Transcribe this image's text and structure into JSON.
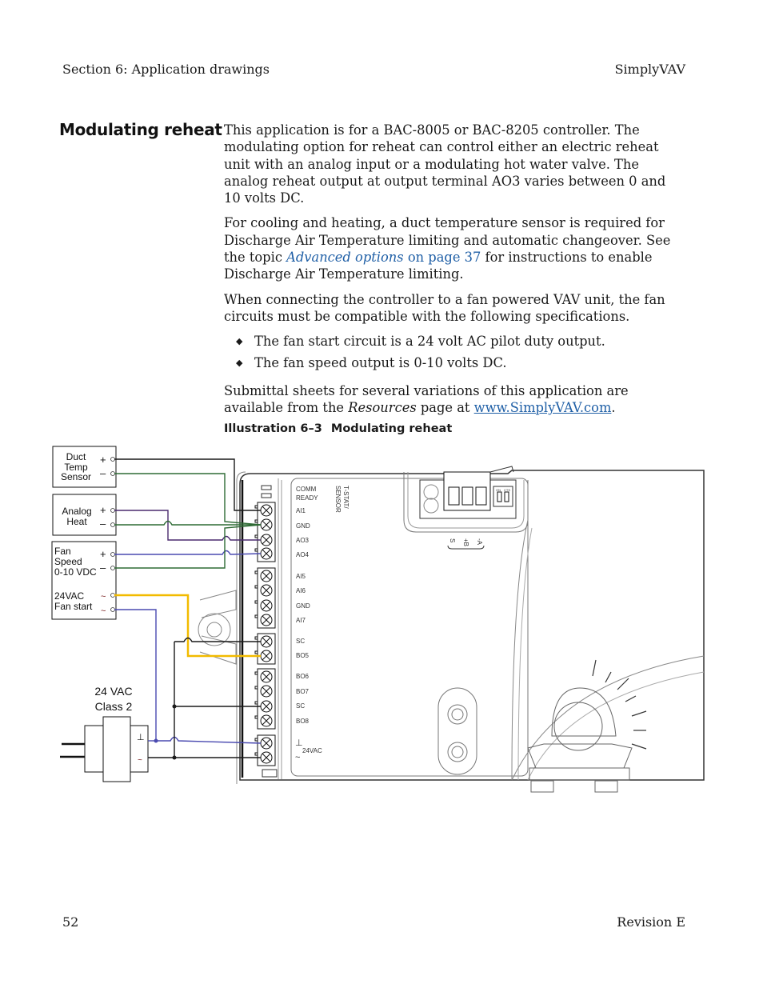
{
  "header": {
    "section": "Section 6: Application drawings",
    "product": "SimplyVAV"
  },
  "footer": {
    "page_number": "52",
    "revision": "Revision E"
  },
  "section_title": "Modulating reheat",
  "body": {
    "p1": "This application is for a BAC-8005 or BAC-8205 controller. The modulating option for reheat can control either an electric reheat unit with an analog input or a modulating hot water valve. The analog reheat output at output terminal AO3 varies between 0 and 10 volts DC.",
    "p2_before": "For cooling and heating, a duct temperature sensor is required for Discharge Air Temperature limiting and automatic changeover. See the topic ",
    "p2_link_italic": "Advanced options",
    "p2_link_page": " on page 37",
    "p2_after": " for instructions to enable Discharge Air Temperature limiting.",
    "p3": "When connecting the controller to a fan powered VAV unit, the fan circuits must be compatible with the following specifications.",
    "bullets": [
      "The fan start circuit is a 24 volt AC pilot duty output.",
      "The fan speed output is 0-10 volts DC."
    ],
    "bullet_glyph": "◆",
    "p4_before": "Submittal sheets for several variations of this application are available from the ",
    "p4_italic": "Resources",
    "p4_mid": " page at ",
    "p4_url": "www.SimplyVAV.com",
    "p4_after": "."
  },
  "caption": {
    "number": "Illustration 6–3",
    "title": "Modulating reheat"
  },
  "diagram": {
    "devices": {
      "duct_sensor": {
        "lines": [
          "Duct",
          "Temp",
          "Sensor"
        ],
        "plus": "+",
        "minus": "–"
      },
      "analog_heat": {
        "lines": [
          "Analog",
          "Heat"
        ],
        "plus": "+",
        "minus": "–"
      },
      "fan": {
        "lines": [
          "Fan",
          "Speed",
          "0-10 VDC"
        ],
        "plus": "+",
        "minus": "–",
        "start_lines": [
          "24VAC",
          "Fan start"
        ],
        "ac1": "~",
        "ac2": "~"
      }
    },
    "transformer": {
      "lines": [
        "24 VAC",
        "Class 2"
      ],
      "ground": "⊥",
      "ac": "~"
    },
    "terminals": {
      "status": [
        "COMM",
        "READY"
      ],
      "header_rotated": [
        "T-STAT/",
        "SENSOR"
      ],
      "group1": [
        "AI1",
        "GND",
        "AO3",
        "AO4"
      ],
      "group2": [
        "AI5",
        "AI6",
        "GND",
        "AI7"
      ],
      "group3": [
        "SC",
        "BO5"
      ],
      "group4": [
        "BO6",
        "BO7",
        "SC",
        "BO8"
      ],
      "power_ground": "⊥",
      "power_ac": "~",
      "power_label": "24VAC"
    },
    "comm_port": {
      "labels": [
        "S",
        "+B",
        "-A"
      ],
      "dip": [
        "ON",
        "CTS"
      ],
      "dip_nums": [
        "1",
        "2"
      ]
    },
    "wire_colors": {
      "black": "#1a1a1a",
      "green": "#2e6b35",
      "purple": "#4a2a6e",
      "blue": "#4a4ab0",
      "yellow": "#f2bb00",
      "grey": "#888888"
    }
  }
}
